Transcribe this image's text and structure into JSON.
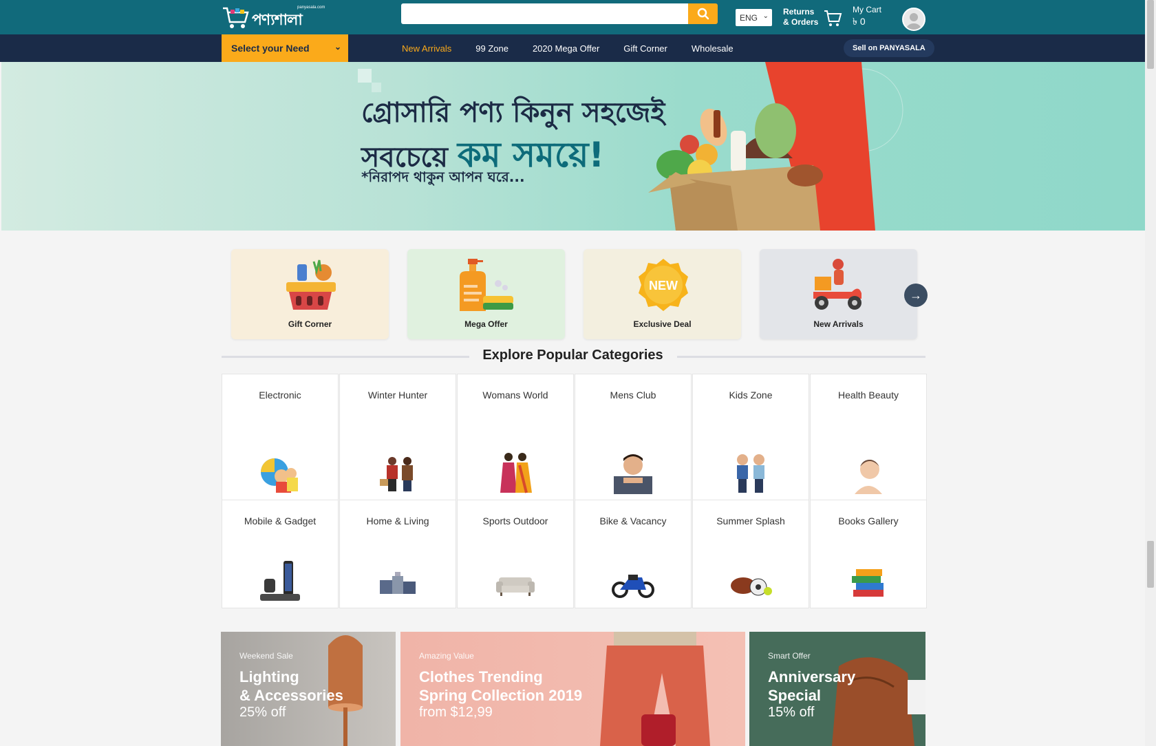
{
  "header": {
    "logo_text": "পণ্যশালা",
    "logo_subtext": "panyasala.com",
    "search_placeholder": "",
    "language": "ENG",
    "returns_line1": "Returns",
    "returns_line2": "& Orders",
    "cart_label": "My Cart",
    "cart_amount": "৳ 0"
  },
  "navbar": {
    "need_label": "Select your Need",
    "links": [
      "New Arrivals",
      "99 Zone",
      "2020 Mega Offer",
      "Gift Corner",
      "Wholesale"
    ],
    "sell_label": "Sell on PANYASALA"
  },
  "hero": {
    "line1": "গ্রোসারি পণ্য কিনুন সহজেই",
    "line2_plain": "সবচেয়ে",
    "line2_accent": "কম সময়ে!",
    "line3": "*নিরাপদ থাকুন আপন ঘরে..."
  },
  "features": [
    {
      "label": "Gift Corner",
      "bg": "#f8eedb"
    },
    {
      "label": "Mega Offer",
      "bg": "#e0f1df"
    },
    {
      "label": "Exclusive Deal",
      "bg": "#f3efdf"
    },
    {
      "label": "New Arrivals",
      "bg": "#e3e5e9"
    }
  ],
  "explore_title": "Explore Popular Categories",
  "categories": [
    "Electronic",
    "Winter Hunter",
    "Womans World",
    "Mens Club",
    "Kids Zone",
    "Health Beauty",
    "Mobile & Gadget",
    "Home & Living",
    "Sports Outdoor",
    "Bike & Vacancy",
    "Summer Splash",
    "Books Gallery"
  ],
  "promos": [
    {
      "small": "Weekend Sale",
      "big1": "Lighting",
      "big2": "& Accessories",
      "sub": "25% off"
    },
    {
      "small": "Amazing Value",
      "big1": "Clothes Trending",
      "big2": "Spring Collection 2019",
      "sub": "from $12,99"
    },
    {
      "small": "Smart Offer",
      "big1": "Anniversary",
      "big2": "Special",
      "sub": "15% off"
    }
  ],
  "colors": {
    "topbar": "#116a7b",
    "navbar": "#1a2b48",
    "accent": "#fbaa1a"
  }
}
